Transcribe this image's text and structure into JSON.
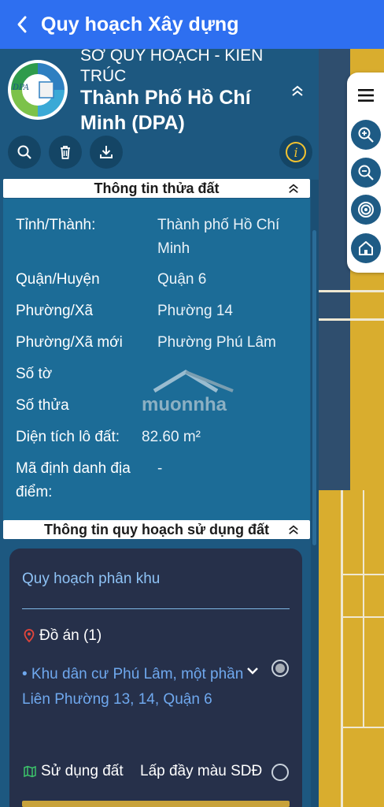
{
  "appbar": {
    "title": "Quy hoạch Xây dựng"
  },
  "header": {
    "org_line1": "SỞ QUY HOẠCH - KIẾN",
    "org_line2": "TRÚC",
    "org_name": "Thành Phố Hồ Chí Minh (DPA)",
    "logo_text": "DPA"
  },
  "parcel": {
    "section_title": "Thông tin thửa đất",
    "rows": [
      {
        "label": "Tỉnh/Thành:",
        "value": "Thành phố Hồ Chí Minh"
      },
      {
        "label": "Quận/Huyện",
        "value": "Quận 6"
      },
      {
        "label": "Phường/Xã",
        "value": "Phường 14"
      },
      {
        "label": "Phường/Xã mới",
        "value": "Phường Phú Lâm"
      },
      {
        "label": "Số tờ",
        "value": ""
      },
      {
        "label": "Số thửa",
        "value": ""
      },
      {
        "label": "Diện tích lô đất:",
        "value": "82.60 m²"
      },
      {
        "label": "Mã định danh địa điểm:",
        "value": "-"
      }
    ],
    "watermark": "muonnha"
  },
  "planning": {
    "section_title": "Thông tin quy hoạch sử dụng đất",
    "card_title": "Quy hoạch phân khu",
    "projects_label": "Đồ án (1)",
    "project_name": "• Khu dân cư Phú Lâm, một phần Liên Phường 13, 14, Quận 6",
    "land_use_label": "Sử dụng đất",
    "fill_color_label": "Lấp đầy màu SDĐ"
  }
}
